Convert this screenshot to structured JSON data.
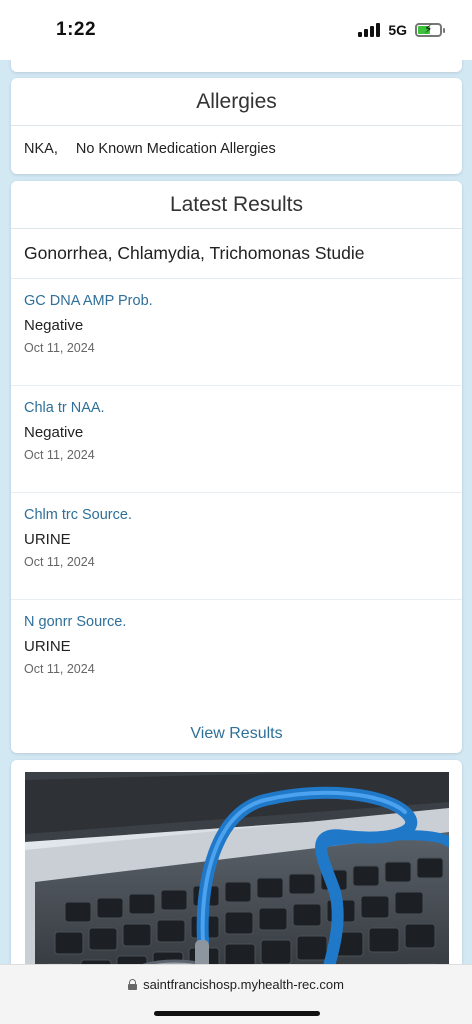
{
  "status_bar": {
    "time": "1:22",
    "network": "5G",
    "battery_level": 0.55
  },
  "allergies": {
    "title": "Allergies",
    "code": "NKA,",
    "description": "No Known Medication Allergies"
  },
  "latest_results": {
    "title": "Latest Results",
    "panel_name": "Gonorrhea, Chlamydia, Trichomonas Studie",
    "items": [
      {
        "name": "GC DNA AMP Prob.",
        "value": "Negative",
        "date": "Oct 11, 2024"
      },
      {
        "name": "Chla tr NAA.",
        "value": "Negative",
        "date": "Oct 11, 2024"
      },
      {
        "name": "Chlm trc Source.",
        "value": "URINE",
        "date": "Oct 11, 2024"
      },
      {
        "name": "N gonrr Source.",
        "value": "URINE",
        "date": "Oct 11, 2024"
      }
    ],
    "view_link": "View Results"
  },
  "url_bar": {
    "url": "saintfrancishosp.myhealth-rec.com"
  },
  "colors": {
    "link": "#2f6f99",
    "page_bg": "#d2e8f3"
  }
}
